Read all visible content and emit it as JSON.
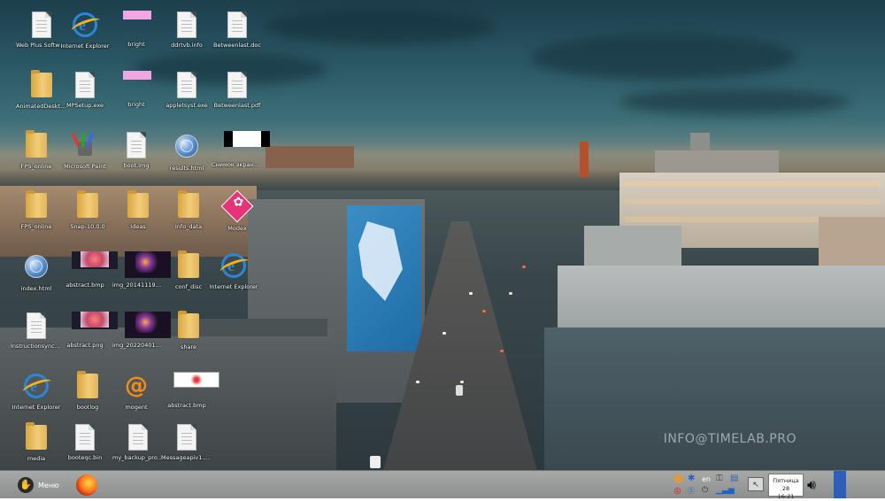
{
  "desktop": {
    "watermark": "INFO@TIMELAB.PRO",
    "icons": [
      {
        "label": "Web Plus Software Installer",
        "type": "doc"
      },
      {
        "label": "Internet Explorer",
        "type": "ie"
      },
      {
        "label": "bright",
        "type": "pink"
      },
      {
        "label": "ddrtvb.info",
        "type": "doc"
      },
      {
        "label": "Betweenlast.doc",
        "type": "doc"
      },
      {
        "label": "AnimatedDesktop",
        "type": "folder"
      },
      {
        "label": "MPSetup.exe",
        "type": "doc"
      },
      {
        "label": "bright",
        "type": "pink"
      },
      {
        "label": "appletsyst.exe",
        "type": "doc"
      },
      {
        "label": "Betweenlast.pdf",
        "type": "doc"
      },
      {
        "label": "FPS_online",
        "type": "folder"
      },
      {
        "label": "Microsoft Paint",
        "type": "paint"
      },
      {
        "label": "boot.img",
        "type": "doc"
      },
      {
        "label": "results.html",
        "type": "globe"
      },
      {
        "label": "Снимок экрана с...",
        "type": "white"
      },
      {
        "label": "FPS_online",
        "type": "folder"
      },
      {
        "label": "Snap-10.0.0",
        "type": "folder"
      },
      {
        "label": "Ideas",
        "type": "folder"
      },
      {
        "label": "Info_data",
        "type": "folder"
      },
      {
        "label": "Modex",
        "type": "gem"
      },
      {
        "label": "index.html",
        "type": "globe"
      },
      {
        "label": "abstract.bmp",
        "type": "thumb-red"
      },
      {
        "label": "img_20141119_175...",
        "type": "thumb-dark"
      },
      {
        "label": "conf_disc",
        "type": "folder"
      },
      {
        "label": "Internet Explorer",
        "type": "ie"
      },
      {
        "label": "Instructionsync.txt",
        "type": "doc"
      },
      {
        "label": "abstract.png",
        "type": "thumb-red"
      },
      {
        "label": "img_20220401_2217...",
        "type": "thumb-dark"
      },
      {
        "label": "share",
        "type": "folder"
      },
      {
        "label": "Internet Explorer",
        "type": "ie-color"
      },
      {
        "label": "bootlog",
        "type": "folder"
      },
      {
        "label": "mogent",
        "type": "at"
      },
      {
        "label": "abstract.bmp",
        "type": "white2"
      },
      {
        "label": "media",
        "type": "folder"
      },
      {
        "label": "booteqc.bin",
        "type": "doc"
      },
      {
        "label": "my_backup_profile.exe",
        "type": "doc"
      },
      {
        "label": "Messageapiv1.pdf",
        "type": "doc"
      }
    ]
  },
  "taskbar": {
    "start_label": "Меню",
    "lang": "en",
    "clock_line1": "Пятница 28",
    "clock_line2": "16:21",
    "colors": {
      "bar": "#9a9c9b",
      "show_desktop": "#2d5fb8"
    }
  }
}
